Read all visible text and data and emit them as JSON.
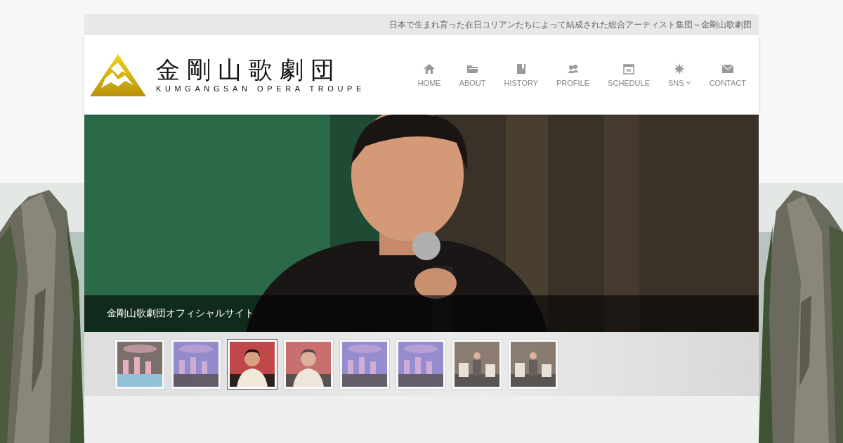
{
  "tagline": "日本で生まれ育った在日コリアンたちによって結成された総合アーティスト集団～金剛山歌劇団",
  "logo": {
    "title": "金剛山歌劇団",
    "subtitle": "KUMGANGSAN OPERA TROUPE"
  },
  "nav": [
    {
      "label": "HOME",
      "kind": "home",
      "dropdown": false
    },
    {
      "label": "ABOUT",
      "kind": "folder",
      "dropdown": false
    },
    {
      "label": "HISTORY",
      "kind": "book",
      "dropdown": false
    },
    {
      "label": "PROFILE",
      "kind": "people",
      "dropdown": false
    },
    {
      "label": "SCHEDULE",
      "kind": "calendar",
      "dropdown": false
    },
    {
      "label": "SNS",
      "kind": "star",
      "dropdown": true
    },
    {
      "label": "CONTACT",
      "kind": "mail",
      "dropdown": false
    }
  ],
  "slide": {
    "caption": "金剛山歌劇団オフィシャルサイト"
  },
  "thumbnails": [
    {
      "kind": "dance",
      "selected": false
    },
    {
      "kind": "stage",
      "selected": false
    },
    {
      "kind": "singer",
      "selected": true
    },
    {
      "kind": "singer",
      "selected": false
    },
    {
      "kind": "stage",
      "selected": false
    },
    {
      "kind": "stage",
      "selected": false
    },
    {
      "kind": "orchestra",
      "selected": false
    },
    {
      "kind": "orchestra",
      "selected": false
    }
  ]
}
